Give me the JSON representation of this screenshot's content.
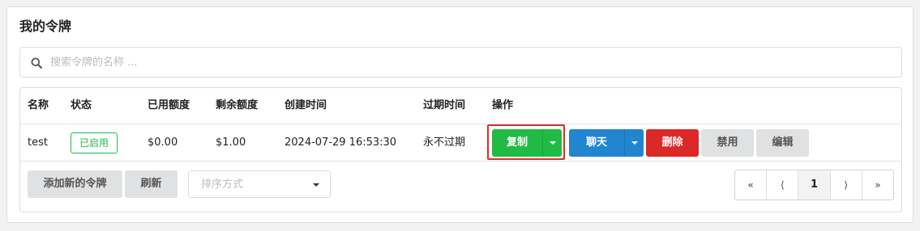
{
  "title": "我的令牌",
  "search": {
    "placeholder": "搜索令牌的名称 ..."
  },
  "table": {
    "headers": {
      "name": "名称",
      "status": "状态",
      "used": "已用额度",
      "remaining": "剩余额度",
      "created": "创建时间",
      "expires": "过期时间",
      "actions": "操作"
    },
    "rows": [
      {
        "name": "test",
        "status": "已启用",
        "used": "$0.00",
        "remaining": "$1.00",
        "created": "2024-07-29 16:53:30",
        "expires": "永不过期",
        "actions": {
          "copy": "复制",
          "chat": "聊天",
          "delete": "删除",
          "disable": "禁用",
          "edit": "编辑"
        }
      }
    ]
  },
  "footer": {
    "add_token": "添加新的令牌",
    "refresh": "刷新",
    "sort_placeholder": "排序方式"
  },
  "pagination": {
    "first": "«",
    "prev": "⟨",
    "current": "1",
    "next": "⟩",
    "last": "»"
  },
  "colors": {
    "green": "#21ba45",
    "blue": "#2185d0",
    "red": "#db2828",
    "highlight": "#e52a2a"
  }
}
